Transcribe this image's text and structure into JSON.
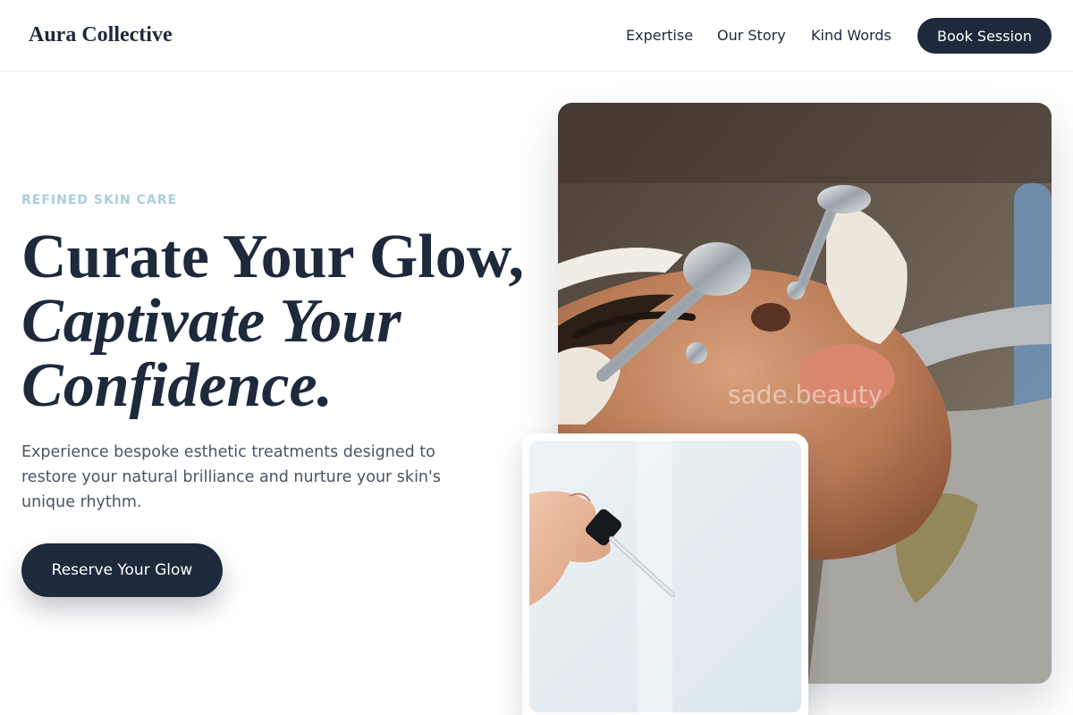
{
  "brand": {
    "name": "Aura Collective"
  },
  "nav": {
    "items": [
      {
        "label": "Expertise"
      },
      {
        "label": "Our Story"
      },
      {
        "label": "Kind Words"
      }
    ],
    "cta_label": "Book Session"
  },
  "hero": {
    "eyebrow": "REFINED SKIN CARE",
    "headline_line1": "Curate Your Glow,",
    "headline_line2": "Captivate Your",
    "headline_line3": "Confidence.",
    "description": "Experience bespoke esthetic treatments designed to restore your natural brilliance and nurture your skin's unique rhythm.",
    "cta_label": "Reserve Your Glow"
  },
  "images": {
    "main_watermark": "sade.beauty"
  },
  "colors": {
    "primary": "#1e293b",
    "eyebrow": "#a9cfda",
    "body_text": "#4b5563"
  }
}
